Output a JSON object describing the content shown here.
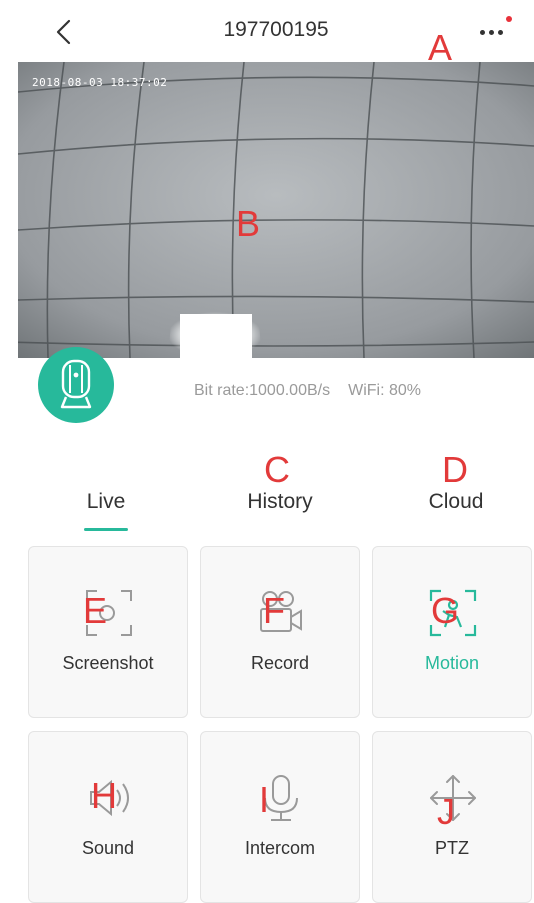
{
  "header": {
    "title": "197700195"
  },
  "video": {
    "timestamp": "2018-08-03 18:37:02"
  },
  "status": {
    "bitrate": "Bit rate:1000.00B/s",
    "wifi": "WiFi: 80%"
  },
  "tabs": [
    {
      "label": "Live",
      "active": true
    },
    {
      "label": "History"
    },
    {
      "label": "Cloud"
    }
  ],
  "tiles": [
    {
      "label": "Screenshot",
      "icon": "screenshot-icon"
    },
    {
      "label": "Record",
      "icon": "record-icon"
    },
    {
      "label": "Motion",
      "icon": "motion-icon",
      "active": true
    },
    {
      "label": "Sound",
      "icon": "sound-icon"
    },
    {
      "label": "Intercom",
      "icon": "intercom-icon"
    },
    {
      "label": "PTZ",
      "icon": "ptz-icon"
    }
  ],
  "annotations": [
    "A",
    "B",
    "C",
    "D",
    "E",
    "F",
    "G",
    "H",
    "I",
    "J"
  ],
  "colors": {
    "accent": "#27b99b",
    "annotation": "#e23a3a",
    "notification": "#e8313a"
  }
}
